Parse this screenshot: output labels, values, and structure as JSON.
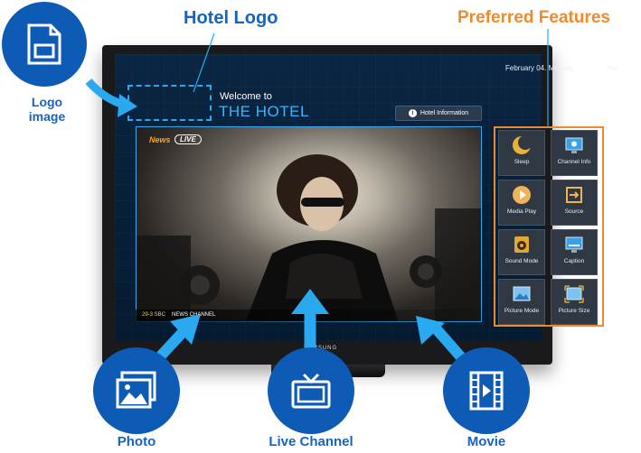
{
  "callouts": {
    "hotel_logo": "Hotel Logo",
    "preferred_features": "Preferred Features",
    "logo_image_line1": "Logo",
    "logo_image_line2": "image",
    "photo": "Photo",
    "live_channel": "Live Channel",
    "movie": "Movie"
  },
  "tv": {
    "brand": "SAMSUNG",
    "date": "February 04. Monday",
    "time": "05:42",
    "ampm": "PM",
    "welcome": "Welcome to",
    "hotel_name": "THE HOTEL",
    "hotel_info_button": "Hotel Information",
    "news_tag": "News",
    "live_tag": "LIVE",
    "channel_number": "29-3 SBC",
    "channel_name": "NEWS CHANNEL"
  },
  "features": [
    {
      "label": "Sleep",
      "icon": "sleep-moon-icon"
    },
    {
      "label": "Channel Info",
      "icon": "channel-info-icon"
    },
    {
      "label": "Media Play",
      "icon": "media-play-icon"
    },
    {
      "label": "Source",
      "icon": "source-input-icon"
    },
    {
      "label": "Sound Mode",
      "icon": "speaker-icon"
    },
    {
      "label": "Caption",
      "icon": "caption-icon"
    },
    {
      "label": "Picture Mode",
      "icon": "picture-mode-icon"
    },
    {
      "label": "Picture Size",
      "icon": "picture-size-icon"
    }
  ],
  "colors": {
    "callout_blue": "#1763c2",
    "feature_orange": "#f08a2a",
    "accent_cyan": "#39b5ff"
  }
}
